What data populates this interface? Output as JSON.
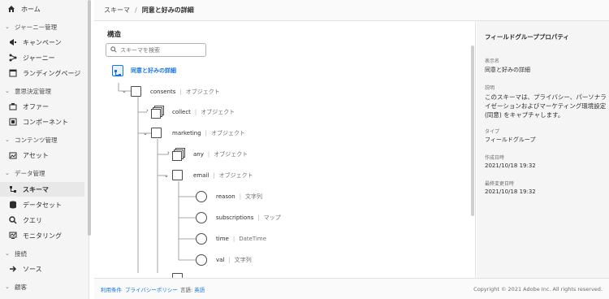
{
  "sidebar": {
    "home": "ホーム",
    "sections": [
      {
        "label": "ジャーニー管理",
        "items": [
          "キャンペーン",
          "ジャーニー",
          "ランディングページ"
        ]
      },
      {
        "label": "意思決定管理",
        "items": [
          "オファー",
          "コンポーネント"
        ]
      },
      {
        "label": "コンテンツ管理",
        "items": [
          "アセット"
        ]
      },
      {
        "label": "データ管理",
        "items": [
          "スキーマ",
          "データセット",
          "クエリ",
          "モニタリング"
        ]
      },
      {
        "label": "接続",
        "items": [
          "ソース"
        ]
      },
      {
        "label": "顧客",
        "items": []
      }
    ],
    "active_item": "スキーマ"
  },
  "header": {
    "crumb_root": "スキーマ",
    "separator": "/",
    "crumb_current": "同意と好みの詳細"
  },
  "structure": {
    "title": "構造",
    "search_placeholder": "スキーマを検索",
    "root_label": "同意と好みの詳細",
    "nodes": [
      {
        "name": "consents",
        "type": "オブジェクト"
      },
      {
        "name": "collect",
        "type": "オブジェクト"
      },
      {
        "name": "marketing",
        "type": "オブジェクト"
      },
      {
        "name": "any",
        "type": "オブジェクト"
      },
      {
        "name": "email",
        "type": "オブジェクト"
      },
      {
        "name": "reason",
        "type": "文字列"
      },
      {
        "name": "subscriptions",
        "type": "マップ"
      },
      {
        "name": "time",
        "type": "DateTime"
      },
      {
        "name": "val",
        "type": "文字列"
      }
    ]
  },
  "properties": {
    "title": "フィールドグループプロパティ",
    "display_name_label": "表示名",
    "display_name": "同意と好みの詳細",
    "description_label": "説明",
    "description": "このスキーマは、プライバシー、パーソナライゼーションおよびマーケティング環境設定 (同意) をキャプチャします。",
    "type_label": "タイプ",
    "type": "フィールドグループ",
    "created_label": "作成日時",
    "created": "2021/10/18 19:32",
    "updated_label": "最終変更日時",
    "updated": "2021/10/18 19:32"
  },
  "footer": {
    "terms": "利用条件",
    "privacy": "プライバシーポリシー",
    "language_label": "言語:",
    "language": "英語",
    "copyright": "Copyright © 2021 Adobe Inc. All rights reserved."
  },
  "colors": {
    "accent": "#1473e6",
    "sidebar_bg": "#f5f5f5",
    "panel_bg": "#f5f5f5"
  },
  "icons": [
    "home-icon",
    "campaign-icon",
    "journey-icon",
    "landing-page-icon",
    "offer-icon",
    "component-icon",
    "asset-icon",
    "schema-icon",
    "dataset-icon",
    "query-icon",
    "monitoring-icon",
    "source-icon",
    "search-icon"
  ]
}
